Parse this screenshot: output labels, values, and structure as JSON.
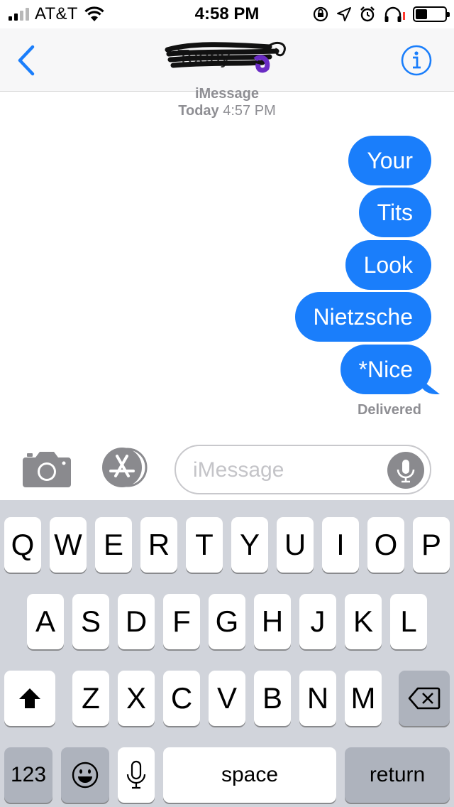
{
  "status_bar": {
    "carrier": "AT&T",
    "time": "4:58 PM",
    "icons": [
      "signal-icon",
      "wifi-icon",
      "orientation-lock-icon",
      "location-icon",
      "alarm-icon",
      "headphones-icon",
      "battery-icon"
    ]
  },
  "nav": {
    "contact_name": "Teeny",
    "back_icon": "chevron-left-icon",
    "info_icon": "info-icon"
  },
  "conversation": {
    "service": "iMessage",
    "day": "Today",
    "time": "4:57 PM",
    "messages": [
      {
        "text": "Your",
        "sender": "me"
      },
      {
        "text": "Tits",
        "sender": "me"
      },
      {
        "text": "Look",
        "sender": "me"
      },
      {
        "text": "Nietzsche",
        "sender": "me"
      },
      {
        "text": "*Nice",
        "sender": "me"
      }
    ],
    "status": "Delivered"
  },
  "input": {
    "placeholder": "iMessage",
    "value": ""
  },
  "keyboard": {
    "row1": [
      "Q",
      "W",
      "E",
      "R",
      "T",
      "Y",
      "U",
      "I",
      "O",
      "P"
    ],
    "row2": [
      "A",
      "S",
      "D",
      "F",
      "G",
      "H",
      "J",
      "K",
      "L"
    ],
    "row3": [
      "Z",
      "X",
      "C",
      "V",
      "B",
      "N",
      "M"
    ],
    "numbers_label": "123",
    "space_label": "space",
    "return_label": "return"
  },
  "colors": {
    "bubble": "#1a7efb",
    "accent": "#1a7efb",
    "keyboard_bg": "#d1d4db",
    "secondary_text": "#8e8e93"
  }
}
